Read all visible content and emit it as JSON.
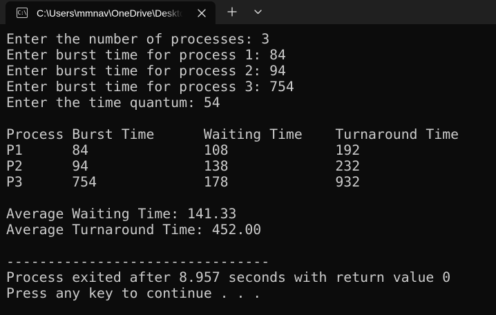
{
  "tab": {
    "icon_text": "C:\\",
    "title": "C:\\Users\\mmnav\\OneDrive\\Desktop"
  },
  "console": {
    "text": "Enter the number of processes: 3\nEnter burst time for process 1: 84\nEnter burst time for process 2: 94\nEnter burst time for process 3: 754\nEnter the time quantum: 54\n\nProcess Burst Time      Waiting Time    Turnaround Time\nP1      84              108             192\nP2      94              138             232\nP3      754             178             932\n\nAverage Waiting Time: 141.33\nAverage Turnaround Time: 452.00\n\n--------------------------------\nProcess exited after 8.957 seconds with return value 0\nPress any key to continue . . ."
  },
  "colors": {
    "titlebar_bg": "#202020",
    "console_bg": "#0c0c0c",
    "console_fg": "#cccccc"
  },
  "icons": {
    "tab_icon": "console-app-icon",
    "close": "close-icon",
    "new_tab": "plus-icon",
    "dropdown": "chevron-down-icon"
  }
}
